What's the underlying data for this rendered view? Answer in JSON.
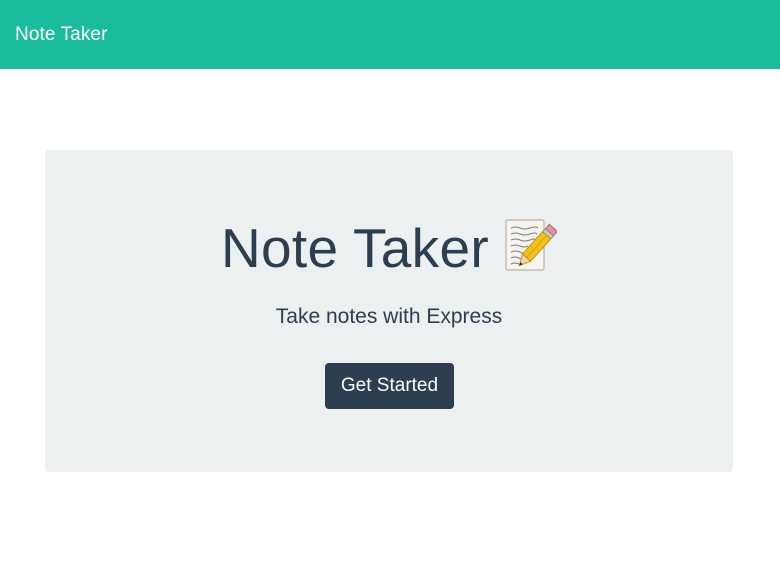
{
  "navbar": {
    "brand": "Note Taker",
    "background": "#1abc9c"
  },
  "hero": {
    "title": "Note Taker",
    "title_icon": "memo-pencil-icon",
    "subtitle": "Take notes with Express",
    "cta_label": "Get Started",
    "background": "#ecf0f1",
    "cta_color": "#2c3e50"
  }
}
